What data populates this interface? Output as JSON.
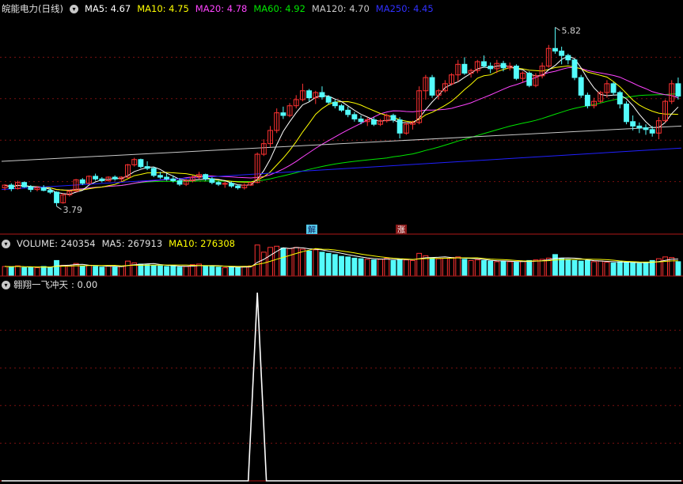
{
  "colors": {
    "bg": "#000000",
    "up": "#ff3232",
    "down": "#54fcfc",
    "grid": "#7a1010",
    "sep": "#b01818",
    "ma5": "#ffffff",
    "ma10": "#ffff00",
    "ma20": "#ff44ff",
    "ma60": "#00e600",
    "ma120": "#c8c8c8",
    "ma250": "#2020ff"
  },
  "price_legend": {
    "name": "皖能电力(日线)",
    "ma5": "MA5: 4.67",
    "ma10": "MA10: 4.75",
    "ma20": "MA20: 4.78",
    "ma60": "MA60: 4.92",
    "ma120": "MA120: 4.70",
    "ma250": "MA250: 4.45"
  },
  "volume_legend": {
    "volume": "VOLUME: 240354",
    "ma5": "MA5: 267913",
    "ma10": "MA10: 276308"
  },
  "indicator_legend": {
    "name": "翱翔一飞冲天",
    "value": ": 0.00"
  },
  "annotations": {
    "high_label": "5.82",
    "low_label": "3.79",
    "mark_1": "解",
    "mark_2": "涨"
  },
  "icon": "chevron-down-icon",
  "chart_data": [
    {
      "type": "candlestick",
      "title": "皖能电力(日线)",
      "ylim": [
        3.6,
        5.95
      ],
      "candles": [
        [
          4.0,
          4.04,
          3.97,
          4.03
        ],
        [
          4.03,
          4.05,
          3.96,
          3.99
        ],
        [
          3.99,
          4.08,
          3.98,
          4.06
        ],
        [
          4.06,
          4.07,
          4.0,
          4.01
        ],
        [
          4.01,
          4.03,
          3.95,
          3.98
        ],
        [
          3.98,
          4.02,
          3.96,
          4.0
        ],
        [
          4.0,
          4.03,
          3.96,
          3.97
        ],
        [
          3.97,
          4.0,
          3.93,
          3.95
        ],
        [
          3.95,
          3.96,
          3.79,
          3.83
        ],
        [
          3.83,
          3.94,
          3.82,
          3.92
        ],
        [
          3.92,
          3.97,
          3.9,
          3.96
        ],
        [
          3.96,
          4.1,
          3.95,
          4.09
        ],
        [
          4.09,
          4.11,
          4.03,
          4.05
        ],
        [
          4.05,
          4.14,
          4.04,
          4.13
        ],
        [
          4.13,
          4.16,
          4.08,
          4.1
        ],
        [
          4.1,
          4.12,
          4.06,
          4.08
        ],
        [
          4.08,
          4.13,
          4.07,
          4.12
        ],
        [
          4.12,
          4.14,
          4.08,
          4.1
        ],
        [
          4.1,
          4.13,
          4.07,
          4.12
        ],
        [
          4.12,
          4.27,
          4.11,
          4.26
        ],
        [
          4.26,
          4.34,
          4.24,
          4.32
        ],
        [
          4.32,
          4.33,
          4.22,
          4.24
        ],
        [
          4.24,
          4.3,
          4.2,
          4.22
        ],
        [
          4.22,
          4.24,
          4.12,
          4.14
        ],
        [
          4.14,
          4.18,
          4.1,
          4.12
        ],
        [
          4.12,
          4.16,
          4.08,
          4.1
        ],
        [
          4.1,
          4.14,
          4.06,
          4.08
        ],
        [
          4.08,
          4.11,
          4.02,
          4.04
        ],
        [
          4.04,
          4.1,
          4.02,
          4.08
        ],
        [
          4.08,
          4.14,
          4.06,
          4.12
        ],
        [
          4.12,
          4.18,
          4.1,
          4.15
        ],
        [
          4.15,
          4.16,
          4.08,
          4.1
        ],
        [
          4.1,
          4.12,
          4.04,
          4.06
        ],
        [
          4.06,
          4.08,
          4.02,
          4.04
        ],
        [
          4.04,
          4.07,
          4.0,
          4.05
        ],
        [
          4.05,
          4.07,
          4.0,
          4.02
        ],
        [
          4.02,
          4.04,
          3.98,
          4.0
        ],
        [
          4.0,
          4.05,
          3.98,
          4.03
        ],
        [
          4.03,
          4.07,
          4.02,
          4.06
        ],
        [
          4.06,
          4.4,
          4.05,
          4.38
        ],
        [
          4.38,
          4.55,
          4.36,
          4.5
        ],
        [
          4.5,
          4.7,
          4.46,
          4.65
        ],
        [
          4.65,
          4.9,
          4.62,
          4.85
        ],
        [
          4.85,
          4.92,
          4.78,
          4.82
        ],
        [
          4.82,
          4.96,
          4.8,
          4.93
        ],
        [
          4.93,
          5.05,
          4.9,
          5.0
        ],
        [
          5.0,
          5.18,
          4.98,
          5.1
        ],
        [
          5.1,
          5.12,
          4.98,
          5.02
        ],
        [
          5.02,
          5.1,
          4.95,
          5.08
        ],
        [
          5.08,
          5.15,
          5.0,
          5.03
        ],
        [
          5.03,
          5.05,
          4.95,
          4.97
        ],
        [
          4.97,
          5.0,
          4.9,
          4.93
        ],
        [
          4.93,
          4.95,
          4.86,
          4.88
        ],
        [
          4.88,
          4.92,
          4.8,
          4.83
        ],
        [
          4.83,
          4.86,
          4.75,
          4.78
        ],
        [
          4.78,
          4.82,
          4.72,
          4.75
        ],
        [
          4.75,
          4.8,
          4.7,
          4.77
        ],
        [
          4.77,
          4.8,
          4.7,
          4.72
        ],
        [
          4.72,
          4.78,
          4.7,
          4.76
        ],
        [
          4.76,
          4.84,
          4.74,
          4.82
        ],
        [
          4.82,
          4.84,
          4.74,
          4.77
        ],
        [
          4.77,
          4.8,
          4.56,
          4.62
        ],
        [
          4.62,
          4.74,
          4.6,
          4.72
        ],
        [
          4.72,
          4.76,
          4.66,
          4.74
        ],
        [
          4.74,
          5.15,
          4.72,
          5.1
        ],
        [
          5.1,
          5.28,
          5.0,
          5.25
        ],
        [
          5.25,
          5.28,
          5.02,
          5.05
        ],
        [
          5.05,
          5.12,
          5.0,
          5.1
        ],
        [
          5.1,
          5.22,
          5.08,
          5.18
        ],
        [
          5.18,
          5.3,
          5.16,
          5.28
        ],
        [
          5.28,
          5.45,
          5.2,
          5.4
        ],
        [
          5.4,
          5.48,
          5.28,
          5.3
        ],
        [
          5.3,
          5.35,
          5.25,
          5.33
        ],
        [
          5.33,
          5.45,
          5.3,
          5.43
        ],
        [
          5.43,
          5.5,
          5.36,
          5.38
        ],
        [
          5.38,
          5.42,
          5.3,
          5.35
        ],
        [
          5.35,
          5.45,
          5.3,
          5.41
        ],
        [
          5.41,
          5.44,
          5.32,
          5.36
        ],
        [
          5.36,
          5.42,
          5.33,
          5.38
        ],
        [
          5.38,
          5.4,
          5.22,
          5.24
        ],
        [
          5.24,
          5.32,
          5.2,
          5.3
        ],
        [
          5.3,
          5.32,
          5.14,
          5.16
        ],
        [
          5.16,
          5.3,
          5.14,
          5.27
        ],
        [
          5.27,
          5.42,
          5.24,
          5.38
        ],
        [
          5.38,
          5.62,
          5.36,
          5.58
        ],
        [
          5.58,
          5.82,
          5.52,
          5.55
        ],
        [
          5.55,
          5.6,
          5.4,
          5.5
        ],
        [
          5.5,
          5.52,
          5.4,
          5.45
        ],
        [
          5.45,
          5.46,
          5.22,
          5.25
        ],
        [
          5.25,
          5.28,
          5.02,
          5.05
        ],
        [
          5.05,
          5.08,
          4.9,
          4.93
        ],
        [
          4.93,
          5.02,
          4.9,
          4.98
        ],
        [
          4.98,
          5.1,
          4.96,
          5.08
        ],
        [
          5.08,
          5.22,
          5.02,
          5.18
        ],
        [
          5.18,
          5.2,
          5.05,
          5.08
        ],
        [
          5.08,
          5.1,
          4.9,
          4.95
        ],
        [
          4.95,
          4.98,
          4.72,
          4.75
        ],
        [
          4.75,
          4.82,
          4.65,
          4.7
        ],
        [
          4.7,
          4.74,
          4.62,
          4.68
        ],
        [
          4.68,
          4.72,
          4.6,
          4.66
        ],
        [
          4.66,
          4.7,
          4.58,
          4.62
        ],
        [
          4.62,
          4.8,
          4.55,
          4.76
        ],
        [
          4.76,
          5.0,
          4.74,
          4.98
        ],
        [
          4.98,
          5.22,
          4.95,
          5.18
        ],
        [
          5.18,
          5.25,
          5.0,
          5.04
        ]
      ],
      "high_annotation": {
        "value": 5.82,
        "label": "5.82"
      },
      "low_annotation": {
        "value": 3.79,
        "label": "3.79"
      },
      "moving_averages": {
        "ma120_start": 4.3,
        "ma120_end": 4.7,
        "ma250_start": 3.98,
        "ma250_end": 4.45
      },
      "grid": true
    },
    {
      "type": "bar",
      "title": "VOLUME",
      "ylim": [
        0,
        650000
      ],
      "last_value": 240354,
      "values": [
        160000,
        150000,
        170000,
        140000,
        150000,
        140000,
        160000,
        140000,
        260000,
        180000,
        170000,
        210000,
        160000,
        180000,
        160000,
        150000,
        170000,
        150000,
        160000,
        250000,
        220000,
        200000,
        190000,
        180000,
        170000,
        160000,
        170000,
        150000,
        160000,
        190000,
        200000,
        170000,
        160000,
        150000,
        140000,
        150000,
        140000,
        160000,
        170000,
        520000,
        400000,
        480000,
        500000,
        470000,
        460000,
        480000,
        450000,
        420000,
        440000,
        400000,
        380000,
        360000,
        330000,
        320000,
        300000,
        290000,
        280000,
        270000,
        280000,
        300000,
        260000,
        280000,
        270000,
        260000,
        380000,
        340000,
        300000,
        290000,
        300000,
        310000,
        320000,
        280000,
        260000,
        270000,
        260000,
        250000,
        240000,
        250000,
        240000,
        230000,
        250000,
        260000,
        270000,
        280000,
        300000,
        360000,
        300000,
        280000,
        260000,
        250000,
        260000,
        240000,
        250000,
        230000,
        220000,
        240000,
        230000,
        220000,
        210000,
        230000,
        260000,
        290000,
        320000,
        310000,
        240354
      ]
    },
    {
      "type": "line",
      "title": "翱翔一飞冲天",
      "ylim": [
        0,
        1
      ],
      "last_value": 0.0,
      "spike_index": 39,
      "spike_value": 1
    }
  ]
}
